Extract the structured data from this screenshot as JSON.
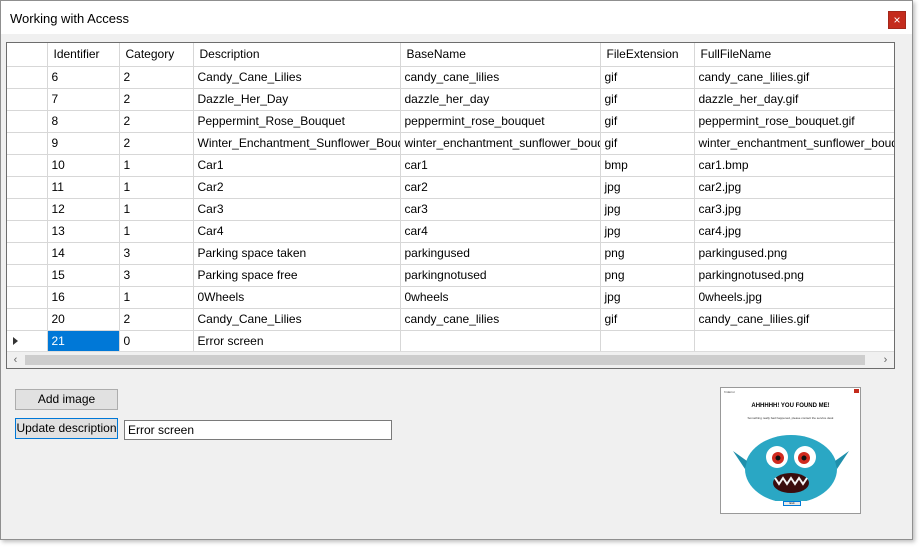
{
  "window": {
    "title": "Working with Access",
    "close_glyph": "×"
  },
  "grid": {
    "columns": [
      "Identifier",
      "Category",
      "Description",
      "BaseName",
      "FileExtension",
      "FullFileName"
    ],
    "rows": [
      [
        "6",
        "2",
        "Candy_Cane_Lilies",
        "candy_cane_lilies",
        "gif",
        "candy_cane_lilies.gif"
      ],
      [
        "7",
        "2",
        "Dazzle_Her_Day",
        "dazzle_her_day",
        "gif",
        "dazzle_her_day.gif"
      ],
      [
        "8",
        "2",
        "Peppermint_Rose_Bouquet",
        "peppermint_rose_bouquet",
        "gif",
        "peppermint_rose_bouquet.gif"
      ],
      [
        "9",
        "2",
        "Winter_Enchantment_Sunflower_Bouquet",
        "winter_enchantment_sunflower_bouquet",
        "gif",
        "winter_enchantment_sunflower_bouquet.gif"
      ],
      [
        "10",
        "1",
        "Car1",
        "car1",
        "bmp",
        "car1.bmp"
      ],
      [
        "11",
        "1",
        "Car2",
        "car2",
        "jpg",
        "car2.jpg"
      ],
      [
        "12",
        "1",
        "Car3",
        "car3",
        "jpg",
        "car3.jpg"
      ],
      [
        "13",
        "1",
        "Car4",
        "car4",
        "jpg",
        "car4.jpg"
      ],
      [
        "14",
        "3",
        "Parking space taken",
        "parkingused",
        "png",
        "parkingused.png"
      ],
      [
        "15",
        "3",
        "Parking space free",
        "parkingnotused",
        "png",
        "parkingnotused.png"
      ],
      [
        "16",
        "1",
        "0Wheels",
        "0wheels",
        "jpg",
        "0wheels.jpg"
      ],
      [
        "20",
        "2",
        "Candy_Cane_Lilies",
        "candy_cane_lilies",
        "gif",
        "candy_cane_lilies.gif"
      ],
      [
        "21",
        "0",
        "Error screen",
        "",
        "",
        ""
      ]
    ],
    "current_row_index": 12,
    "selected_cell": "21",
    "scroll_left_glyph": "‹",
    "scroll_right_glyph": "›"
  },
  "buttons": {
    "add_image": "Add image",
    "update_description": "Update description"
  },
  "description_input": {
    "value": "Error screen"
  },
  "preview": {
    "window_title": "frmError",
    "heading": "AHHHHH! YOU FOUND ME!",
    "message": "Something really bad happened, please contact the service desk",
    "button": "Exit"
  },
  "colors": {
    "selection": "#0078d7",
    "close_button": "#c42b1c",
    "monster_body": "#2aa7c4"
  },
  "icons": {
    "close": "close-icon",
    "current_row": "row-pointer-icon",
    "scroll_left": "chevron-left-icon",
    "scroll_right": "chevron-right-icon"
  }
}
